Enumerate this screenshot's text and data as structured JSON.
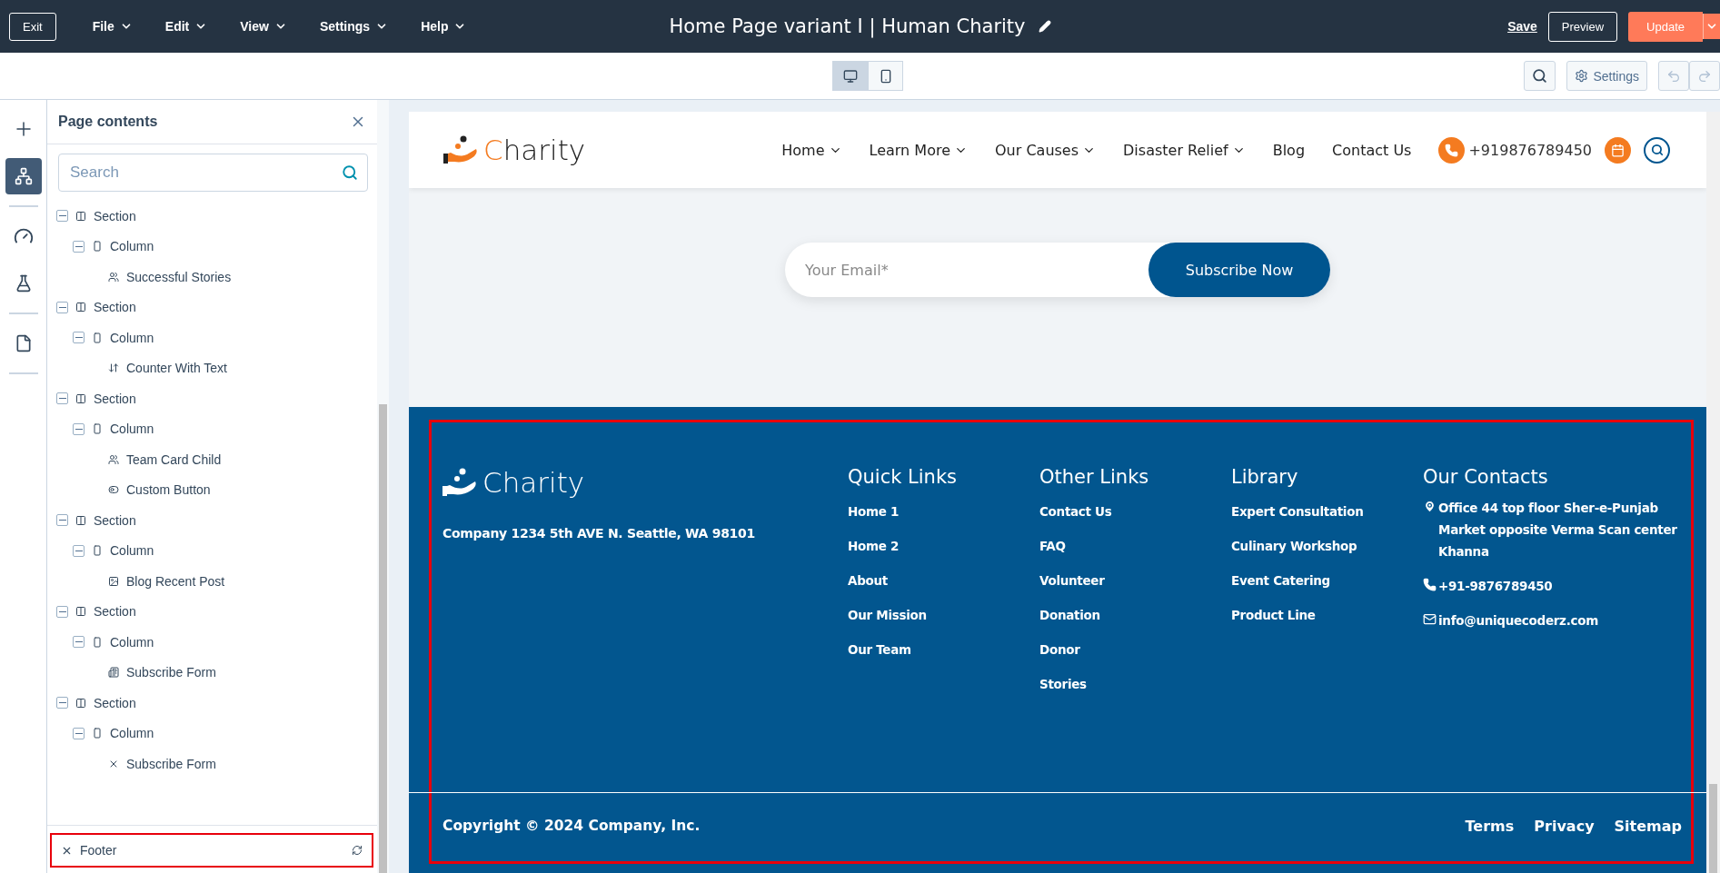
{
  "topbar": {
    "exit": "Exit",
    "menus": [
      "File",
      "Edit",
      "View",
      "Settings",
      "Help"
    ],
    "title": "Home Page variant I | Human Charity",
    "save": "Save",
    "preview": "Preview",
    "update": "Update"
  },
  "toolbar": {
    "devices": [
      {
        "kind": "desktop",
        "selected": true
      },
      {
        "kind": "mobile",
        "selected": false
      }
    ],
    "settings": "Settings"
  },
  "sidebar": {
    "title": "Page contents",
    "search": {
      "placeholder": "Search"
    },
    "tree": [
      {
        "kind": "section",
        "label": "Section",
        "expanded": true,
        "children": [
          {
            "kind": "column",
            "label": "Column",
            "expanded": true,
            "children": [
              {
                "kind": "people",
                "label": "Successful Stories"
              }
            ]
          }
        ]
      },
      {
        "kind": "section",
        "label": "Section",
        "expanded": true,
        "children": [
          {
            "kind": "column",
            "label": "Column",
            "expanded": true,
            "children": [
              {
                "kind": "counter",
                "label": "Counter With Text"
              }
            ]
          }
        ]
      },
      {
        "kind": "section",
        "label": "Section",
        "expanded": true,
        "children": [
          {
            "kind": "column",
            "label": "Column",
            "expanded": true,
            "children": [
              {
                "kind": "people",
                "label": "Team Card Child"
              },
              {
                "kind": "toggle",
                "label": "Custom Button"
              }
            ]
          }
        ]
      },
      {
        "kind": "section",
        "label": "Section",
        "expanded": true,
        "children": [
          {
            "kind": "column",
            "label": "Column",
            "expanded": true,
            "children": [
              {
                "kind": "image",
                "label": "Blog Recent Post"
              }
            ]
          }
        ]
      },
      {
        "kind": "section",
        "label": "Section",
        "expanded": true,
        "children": [
          {
            "kind": "column",
            "label": "Column",
            "expanded": true,
            "children": [
              {
                "kind": "form",
                "label": "Subscribe Form"
              }
            ]
          }
        ]
      },
      {
        "kind": "section",
        "label": "Section",
        "expanded": true,
        "children": [
          {
            "kind": "column",
            "label": "Column",
            "expanded": true,
            "children": [
              {
                "kind": "cross",
                "label": "Subscribe Form"
              }
            ]
          }
        ]
      }
    ],
    "footer_item": {
      "label": "Footer",
      "highlighted": true
    }
  },
  "site": {
    "header": {
      "logo": "Charity",
      "nav": [
        {
          "label": "Home",
          "dropdown": true
        },
        {
          "label": "Learn More",
          "dropdown": true
        },
        {
          "label": "Our Causes",
          "dropdown": true
        },
        {
          "label": "Disaster Relief",
          "dropdown": true
        },
        {
          "label": "Blog",
          "dropdown": false
        },
        {
          "label": "Contact Us",
          "dropdown": false
        }
      ],
      "phone": "+919876789450"
    },
    "subscribe": {
      "placeholder": "Your Email*",
      "button": "Subscribe Now"
    },
    "footer": {
      "highlighted": true,
      "logo": "Charity",
      "address": "Company 1234 5th AVE N. Seattle, WA 98101",
      "columns": [
        {
          "title": "Quick Links",
          "links": [
            "Home 1",
            "Home 2",
            "About",
            "Our Mission",
            "Our Team"
          ]
        },
        {
          "title": "Other Links",
          "links": [
            "Contact Us",
            "FAQ",
            "Volunteer",
            "Donation",
            "Donor",
            "Stories"
          ]
        },
        {
          "title": "Library",
          "links": [
            "Expert Consultation",
            "Culinary Workshop",
            "Event Catering",
            "Product Line"
          ]
        }
      ],
      "contacts": {
        "title": "Our Contacts",
        "items": [
          {
            "kind": "location",
            "text": "Office 44 top floor Sher-e-Punjab Market opposite Verma Scan center Khanna"
          },
          {
            "kind": "phone",
            "text": "+91-9876789450"
          },
          {
            "kind": "email",
            "text": "info@uniquecoderz.com"
          }
        ]
      },
      "copyright": "Copyright © 2024 Company, Inc.",
      "bottom_links": [
        "Terms",
        "Privacy",
        "Sitemap"
      ]
    }
  }
}
